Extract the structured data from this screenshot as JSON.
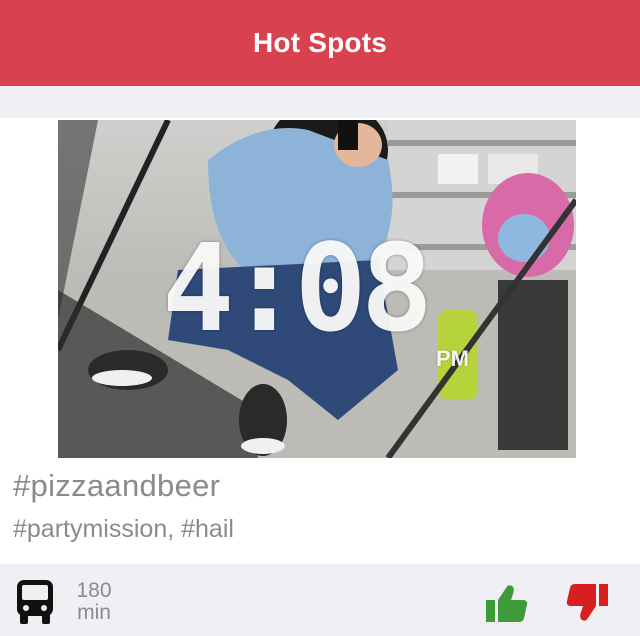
{
  "header": {
    "title": "Hot Spots"
  },
  "post": {
    "photo_overlay_time": "4:08",
    "photo_overlay_ampm": "PM",
    "title": "#pizzaandbeer",
    "tags": "#partymission, #hail"
  },
  "footer": {
    "transport_icon": "bus-icon",
    "minutes_value": "180",
    "minutes_unit": "min",
    "like_icon": "thumbs-up-icon",
    "dislike_icon": "thumbs-down-icon"
  },
  "colors": {
    "header": "#d8414e",
    "background_gray": "#efeff4",
    "text_gray": "#8a8a8f",
    "like_green": "#3f9b3a",
    "dislike_red": "#d81e20"
  }
}
